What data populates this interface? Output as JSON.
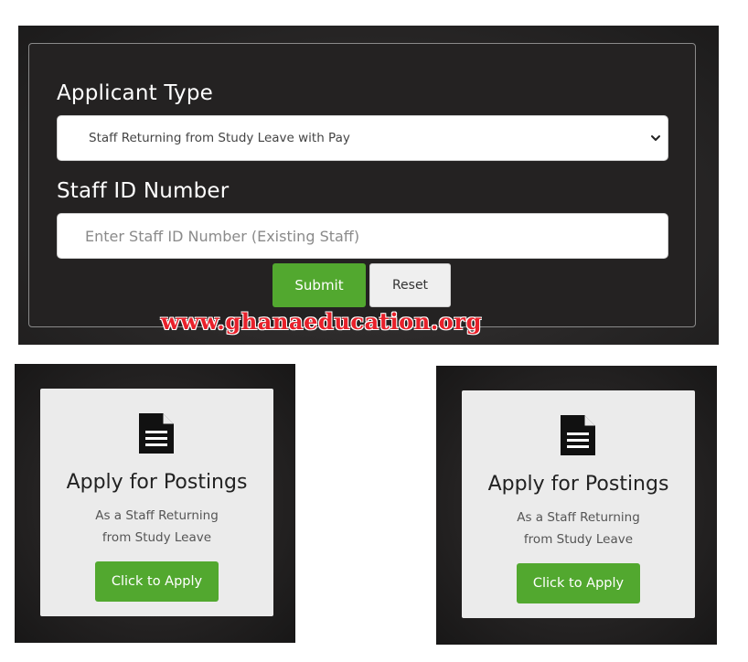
{
  "form": {
    "applicant_type_label": "Applicant Type",
    "applicant_type_selected": "Staff Returning from Study Leave with Pay",
    "staff_id_label": "Staff ID Number",
    "staff_id_placeholder": "Enter Staff ID Number (Existing Staff)",
    "staff_id_value": "",
    "submit_label": "Submit",
    "reset_label": "Reset"
  },
  "watermark": "www.ghanaeducation.org",
  "cards": [
    {
      "title": "Apply for Postings",
      "subtitle_line1": "As a Staff Returning",
      "subtitle_line2": "from Study Leave",
      "button_label": "Click to Apply",
      "icon": "document-icon"
    },
    {
      "title": "Apply for Postings",
      "subtitle_line1": "As a Staff Returning",
      "subtitle_line2": "from Study Leave",
      "button_label": "Click to Apply",
      "icon": "document-icon"
    }
  ],
  "colors": {
    "accent_green": "#52a82f",
    "panel_dark": "#242222",
    "card_bg": "#ebebeb",
    "watermark_red": "#e8202a"
  }
}
